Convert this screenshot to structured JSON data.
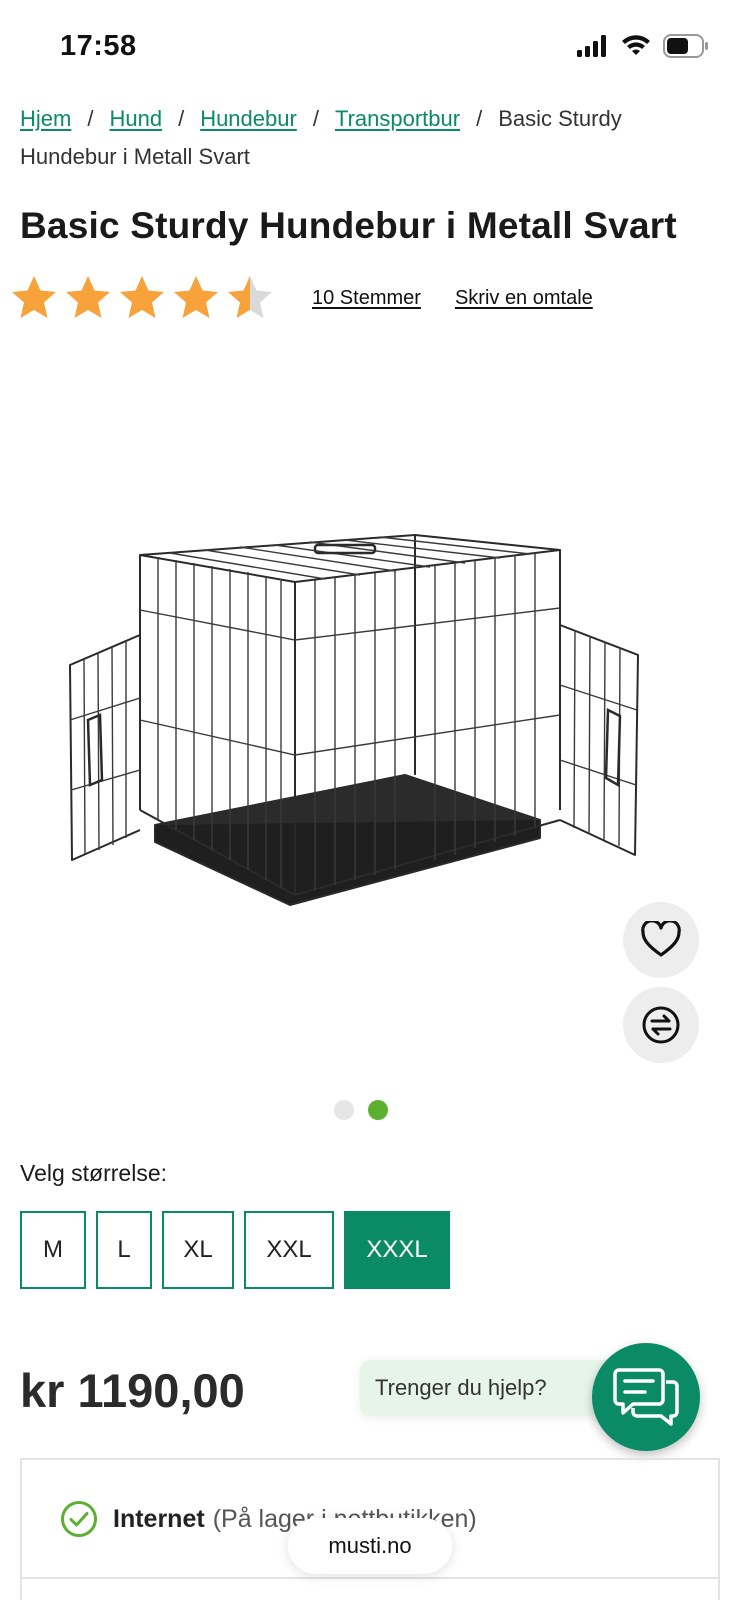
{
  "status_bar": {
    "time": "17:58"
  },
  "breadcrumb": {
    "items": [
      {
        "label": "Hjem"
      },
      {
        "label": "Hund"
      },
      {
        "label": "Hundebur"
      },
      {
        "label": "Transportbur"
      }
    ],
    "separator": "/",
    "current": "Basic Sturdy Hundebur i Metall Svart"
  },
  "product": {
    "title": "Basic Sturdy Hundebur i Metall Svart",
    "rating": 4.5,
    "rating_max": 5,
    "votes_label": "10 Stemmer",
    "write_review_label": "Skriv en omtale",
    "image_icon": "dog-crate-image",
    "gallery_total": 2,
    "gallery_active": 2,
    "size_label": "Velg størrelse:",
    "sizes": [
      "M",
      "L",
      "XL",
      "XXL",
      "XXXL"
    ],
    "selected_size": "XXXL",
    "price": "kr 1190,00"
  },
  "actions": {
    "favorite_icon": "heart-icon",
    "compare_icon": "compare-arrows-icon"
  },
  "help": {
    "label": "Trenger du hjelp?",
    "chat_icon": "chat-bubbles-icon"
  },
  "delivery": {
    "channel": "Internet",
    "status": "(På lager i nettbutikken)"
  },
  "browser": {
    "url": "musti.no"
  },
  "colors": {
    "brand_green": "#0b8a66",
    "star_orange": "#f7a23b",
    "dot_active": "#5cb030",
    "check_green": "#5cb030"
  }
}
